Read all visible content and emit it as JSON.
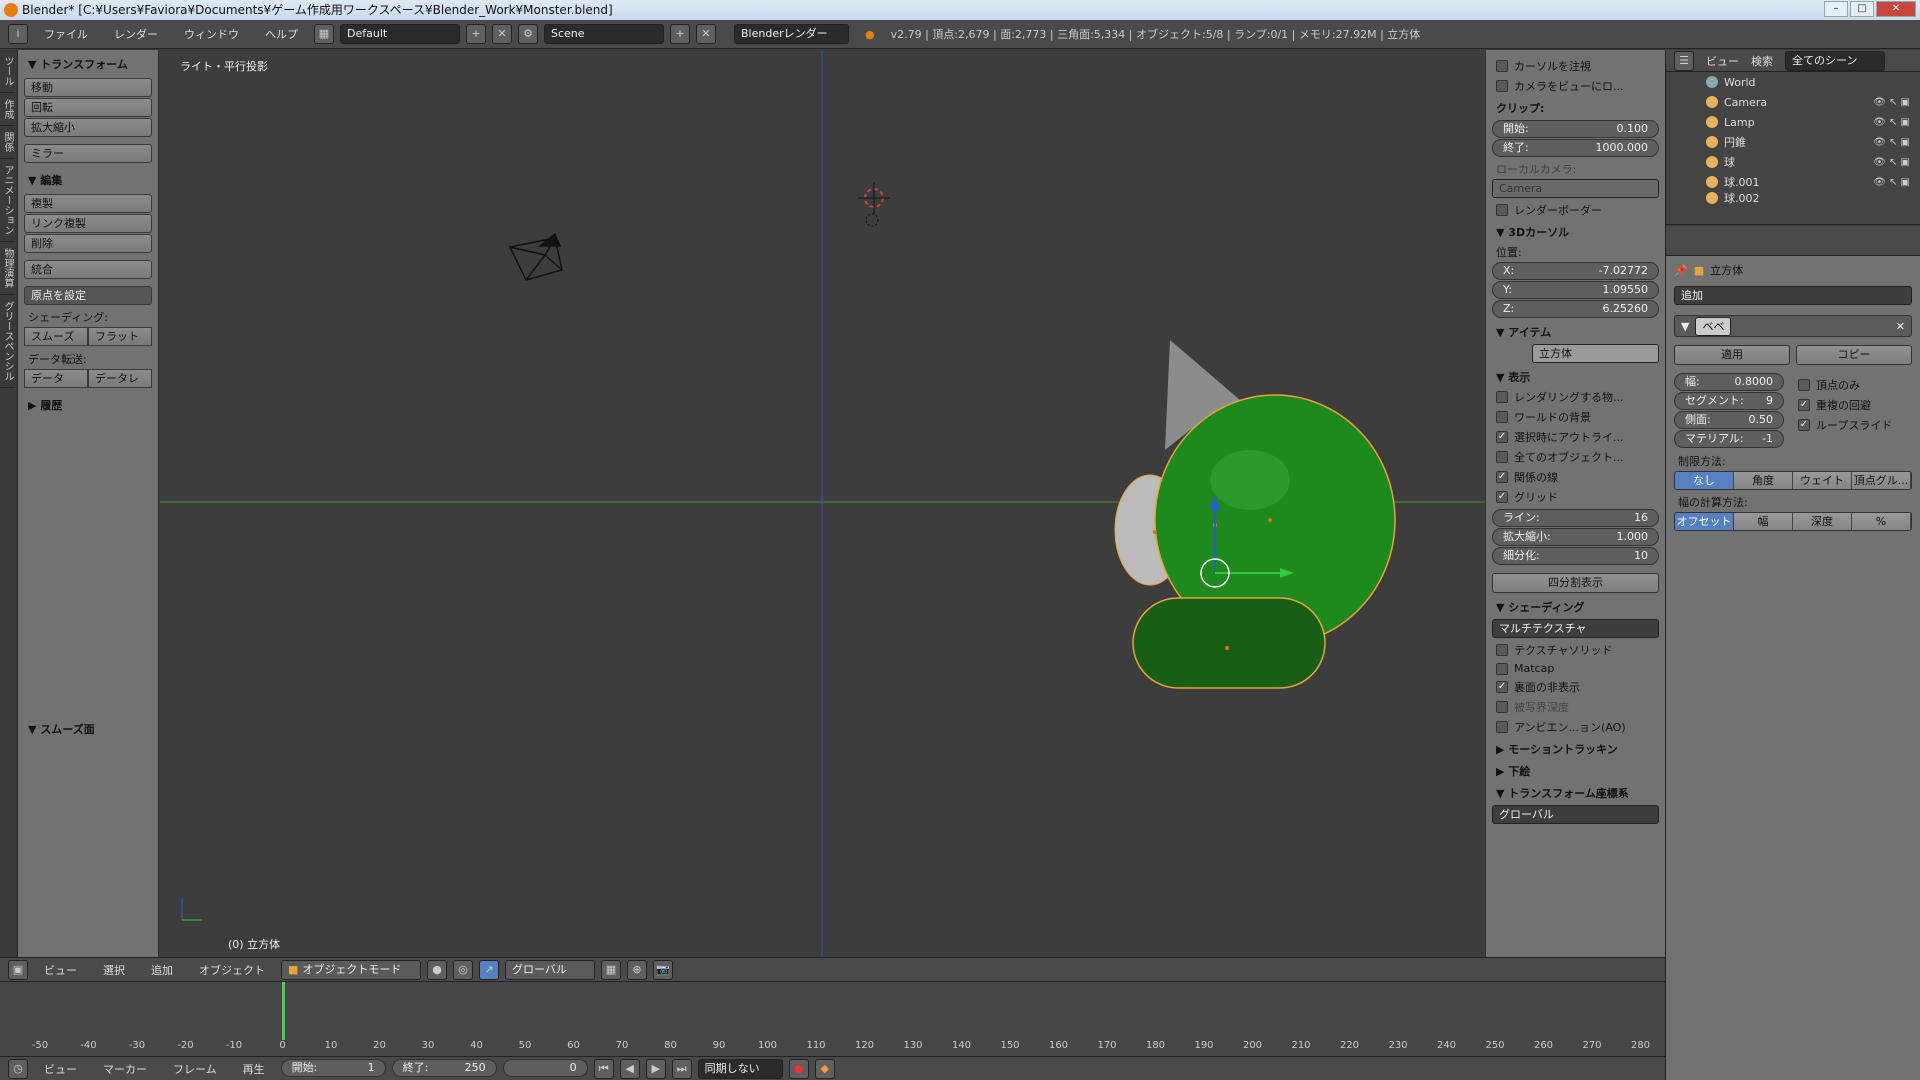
{
  "window": {
    "title": "Blender* [C:¥Users¥Faviora¥Documents¥ゲーム作成用ワークスペース¥Blender_Work¥Monster.blend]"
  },
  "infobar": {
    "menus": [
      "ファイル",
      "レンダー",
      "ウィンドウ",
      "ヘルプ"
    ],
    "layout": "Default",
    "scene": "Scene",
    "engine": "Blenderレンダー",
    "stats": "v2.79 | 頂点:2,679 | 面:2,773 | 三角面:5,334 | オブジェクト:5/8 | ランプ:0/1 | メモリ:27.92M | 立方体"
  },
  "tooltabs": [
    "ツール",
    "作成",
    "関係",
    "アニメーション",
    "物理演算",
    "グリースペンシル"
  ],
  "toolshelf": {
    "transform_title": "▼ トランスフォーム",
    "transform_buttons": [
      "移動",
      "回転",
      "拡大縮小"
    ],
    "mirror": "ミラー",
    "edit_title": "▼ 編集",
    "edit_buttons": [
      "複製",
      "リンク複製",
      "削除"
    ],
    "join": "統合",
    "origin": "原点を設定",
    "shading_label": "シェーディング:",
    "smooth": "スムーズ",
    "flat": "フラット",
    "data_transfer_label": "データ転送:",
    "data": "データ",
    "data_layouts": "データレ",
    "history": "▶ 履歴",
    "smooth_faces": "▼ スムーズ面"
  },
  "viewport": {
    "label": "ライト・平行投影",
    "object": "(0) 立方体"
  },
  "nprop": {
    "cursor_lock": "カーソルを注視",
    "lock_camera": "カメラをビューにロ...",
    "clip": "クリップ:",
    "start_label": "開始:",
    "start": "0.100",
    "end_label": "終了:",
    "end": "1000.000",
    "local_camera": "ローカルカメラ:",
    "camera": "Camera",
    "render_border": "レンダーボーダー",
    "cursor_title": "▼ 3Dカーソル",
    "location": "位置:",
    "x_label": "X:",
    "x": "-7.02772",
    "y_label": "Y:",
    "y": "1.09550",
    "z_label": "Z:",
    "z": "6.25260",
    "item_title": "▼ アイテム",
    "item_name": "立方体",
    "display_title": "▼ 表示",
    "only_render": "レンダリングする物...",
    "world_bg": "ワールドの背景",
    "outline_sel": "選択時にアウトライ...",
    "all_obj": "全てのオブジェクト...",
    "relations": "関係の線",
    "grid": "グリッド",
    "lines_label": "ライン:",
    "lines": "16",
    "scale_label": "拡大縮小:",
    "scale": "1.000",
    "subdiv_label": "細分化:",
    "subdiv": "10",
    "quad": "四分割表示",
    "shading_title": "▼ シェーディング",
    "multitex": "マルチテクスチャ",
    "textured_solid": "テクスチャソリッド",
    "matcap": "Matcap",
    "backface": "裏面の非表示",
    "dof": "被写界深度",
    "ao": "アンビエン...ョン(AO)",
    "motion_tracking": "モーショントラッキン",
    "background": "下絵",
    "transform_orient": "▼ トランスフォーム座標系",
    "global": "グローバル"
  },
  "outliner": {
    "view": "ビュー",
    "search": "検索",
    "scenes": "全てのシーン",
    "items": [
      "World",
      "Camera",
      "Lamp",
      "円錐",
      "球",
      "球.001",
      "球.002"
    ]
  },
  "props": {
    "object_name": "立方体",
    "add": "追加",
    "mod_name": "ベベ",
    "apply": "適用",
    "copy": "コピー",
    "width_label": "幅:",
    "width": "0.8000",
    "segments_label": "セグメント:",
    "segments": "9",
    "profile_label": "側面:",
    "profile": "0.50",
    "material_label": "マテリアル:",
    "material": "-1",
    "only_vertices": "頂点のみ",
    "clamp": "重複の回避",
    "loop_slide": "ループスライド",
    "limit_label": "制限方法:",
    "limits": [
      "なし",
      "角度",
      "ウェイト",
      "頂点グル..."
    ],
    "width_method_label": "幅の計算方法:",
    "width_methods": [
      "オフセット",
      "幅",
      "深度",
      "%"
    ]
  },
  "vp_header": {
    "menus": [
      "ビュー",
      "選択",
      "追加",
      "オブジェクト"
    ],
    "mode": "オブジェクトモード",
    "orientation": "グローバル"
  },
  "timeline": {
    "ticks": [
      "-50",
      "-40",
      "-30",
      "-20",
      "-10",
      "0",
      "10",
      "20",
      "30",
      "40",
      "50",
      "60",
      "70",
      "80",
      "90",
      "100",
      "110",
      "120",
      "130",
      "140",
      "150",
      "160",
      "170",
      "180",
      "190",
      "200",
      "210",
      "220",
      "230",
      "240",
      "250",
      "260",
      "270",
      "280"
    ],
    "menus": [
      "ビュー",
      "マーカー",
      "フレーム",
      "再生"
    ],
    "start_label": "開始:",
    "start": "1",
    "end_label": "終了:",
    "end": "250",
    "current": "0",
    "sync": "同期しない"
  }
}
